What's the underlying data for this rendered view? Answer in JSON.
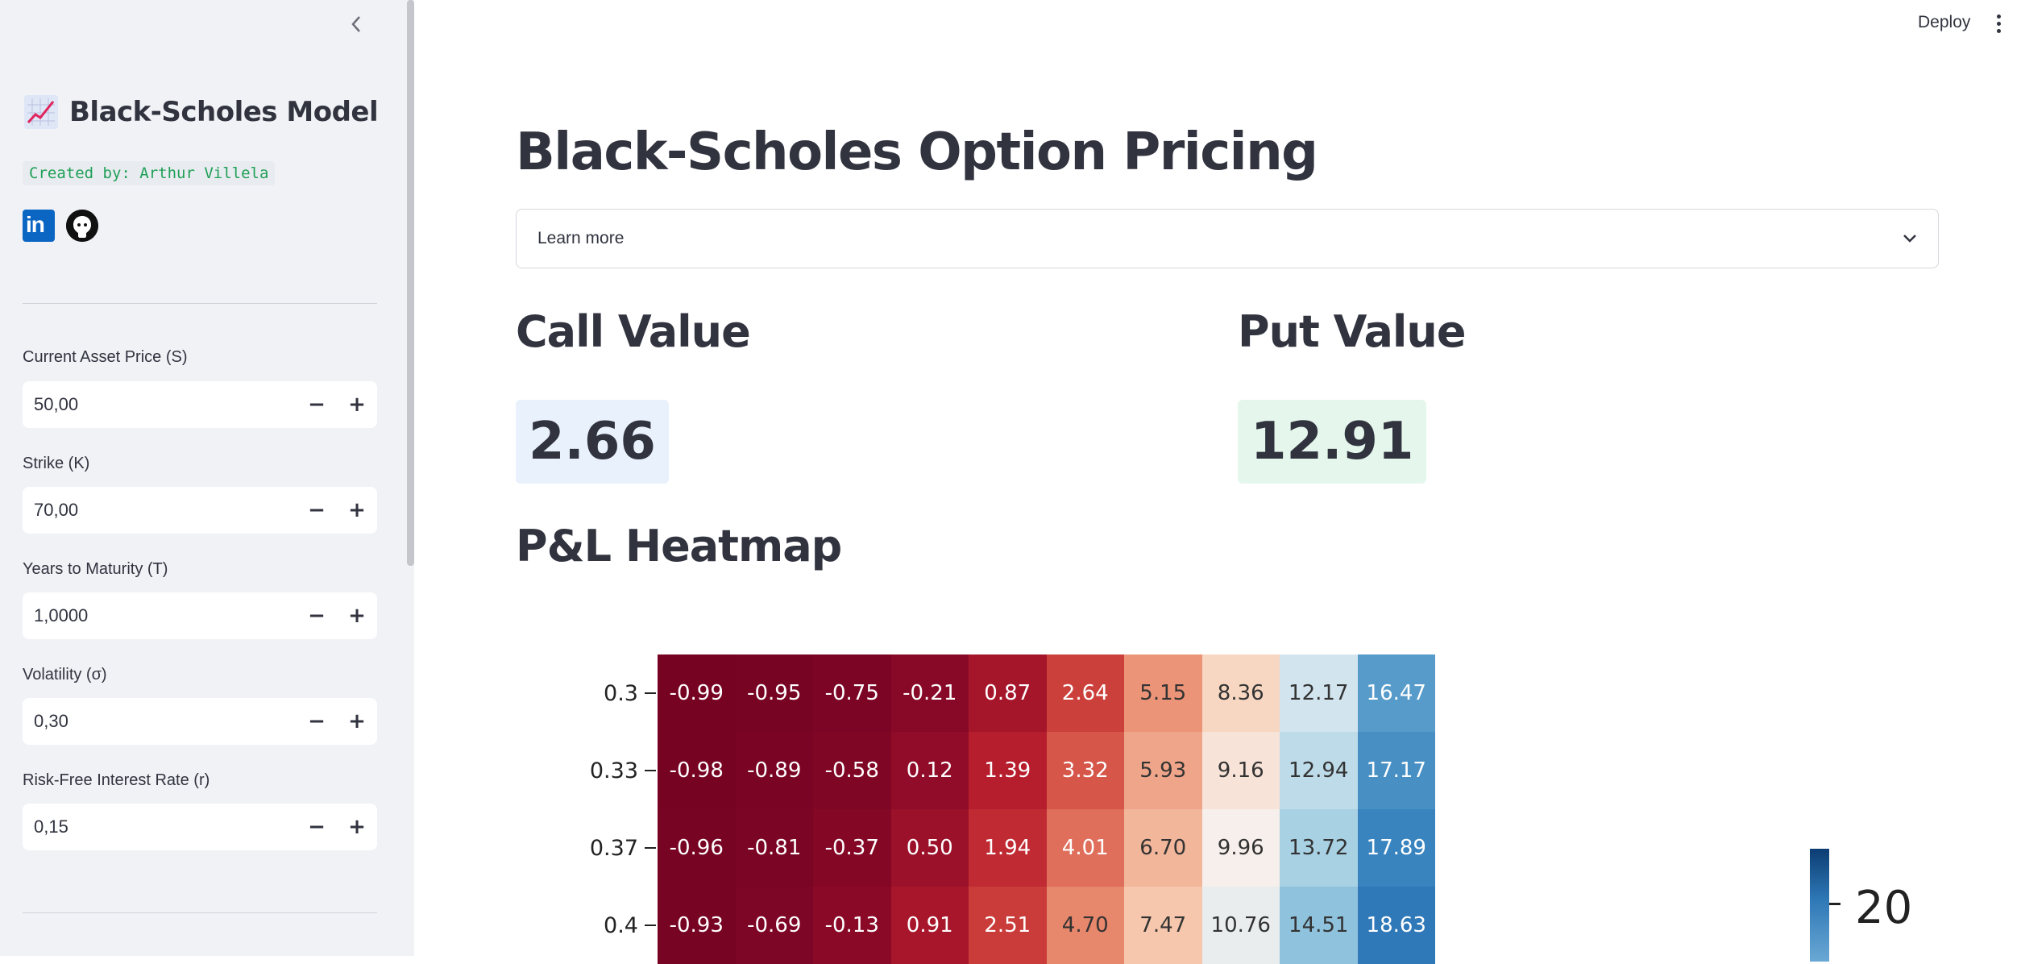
{
  "sidebar": {
    "title": "Black-Scholes Model",
    "title_icon": "chart-increasing-emoji",
    "created_by": "Created by: Arthur Villela",
    "social": [
      {
        "icon": "linkedin-icon",
        "text": "in"
      },
      {
        "icon": "github-icon"
      }
    ],
    "fields": [
      {
        "label": "Current Asset Price (S)",
        "value": "50,00"
      },
      {
        "label": "Strike (K)",
        "value": "70,00"
      },
      {
        "label": "Years to Maturity (T)",
        "value": "1,0000"
      },
      {
        "label": "Volatility (σ)",
        "value": "0,30"
      },
      {
        "label": "Risk-Free Interest Rate (r)",
        "value": "0,15"
      }
    ],
    "stepper_minus": "−",
    "stepper_plus": "+"
  },
  "header": {
    "deploy_label": "Deploy"
  },
  "main": {
    "title": "Black-Scholes Option Pricing",
    "expander_label": "Learn more",
    "call_title": "Call Value",
    "call_value": "2.66",
    "put_title": "Put Value",
    "put_value": "12.91",
    "heatmap_title": "P&L Heatmap"
  },
  "colors": {
    "sidebar_bg": "#f0f2f6",
    "call_bg": "#e8f1fc",
    "put_bg": "#e5f7ec",
    "text": "#31333f"
  },
  "chart_data": {
    "type": "heatmap",
    "title": "",
    "colormap": "RdBu",
    "y": [
      "0.3",
      "0.33",
      "0.37",
      "0.4"
    ],
    "values": [
      [
        -0.99,
        -0.95,
        -0.75,
        -0.21,
        0.87,
        2.64,
        5.15,
        8.36,
        12.17,
        16.47
      ],
      [
        -0.98,
        -0.89,
        -0.58,
        0.12,
        1.39,
        3.32,
        5.93,
        9.16,
        12.94,
        17.17
      ],
      [
        -0.96,
        -0.81,
        -0.37,
        0.5,
        1.94,
        4.01,
        6.7,
        9.96,
        13.72,
        17.89
      ],
      [
        -0.93,
        -0.69,
        -0.13,
        0.91,
        2.51,
        4.7,
        7.47,
        10.76,
        14.51,
        18.63
      ]
    ],
    "labels": [
      [
        "-0.99",
        "-0.95",
        "-0.75",
        "-0.21",
        "0.87",
        "2.64",
        "5.15",
        "8.36",
        "12.17",
        "16.47"
      ],
      [
        "-0.98",
        "-0.89",
        "-0.58",
        "0.12",
        "1.39",
        "3.32",
        "5.93",
        "9.16",
        "12.94",
        "17.17"
      ],
      [
        "-0.96",
        "-0.81",
        "-0.37",
        "0.50",
        "1.94",
        "4.01",
        "6.70",
        "9.96",
        "13.72",
        "17.89"
      ],
      [
        "-0.93",
        "-0.69",
        "-0.13",
        "0.91",
        "2.51",
        "4.70",
        "7.47",
        "10.76",
        "14.51",
        "18.63"
      ]
    ],
    "colorbar_tick": "20"
  }
}
